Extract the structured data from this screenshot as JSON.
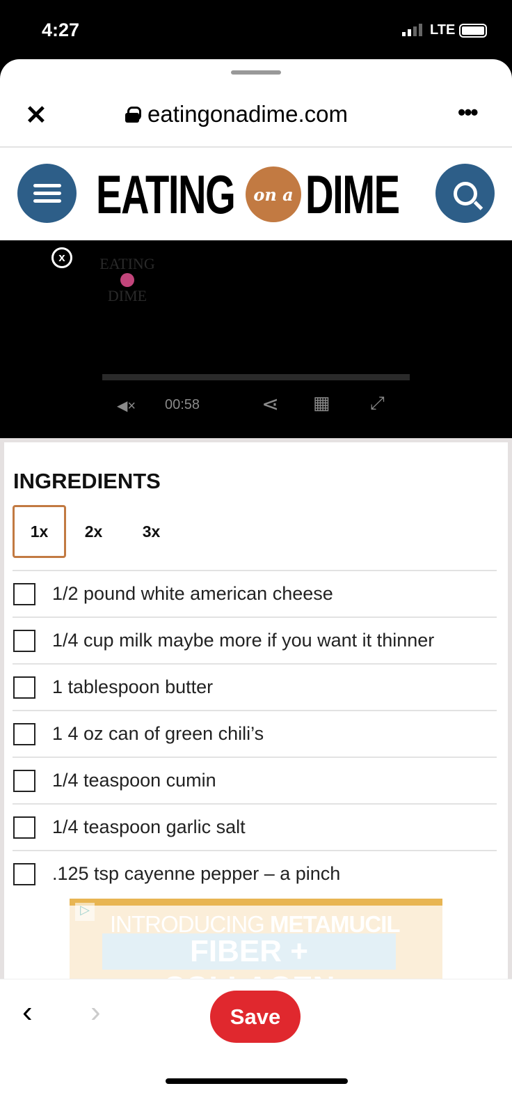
{
  "status": {
    "time": "4:27",
    "network": "LTE"
  },
  "browser": {
    "url": "eatingonadime.com",
    "close": "✕",
    "more": "•••"
  },
  "site": {
    "logo_left": "EATING",
    "logo_mid": "on a",
    "logo_right": "DIME"
  },
  "video": {
    "watermark_top": "EATING",
    "watermark_bottom": "DIME",
    "time": "00:58",
    "close": "x"
  },
  "ingredients": {
    "heading": "INGREDIENTS",
    "servings": [
      "1x",
      "2x",
      "3x"
    ],
    "selected": "1x",
    "items": [
      "1/2 pound white american cheese",
      "1/4 cup milk maybe more if you want it thinner",
      "1 tablespoon butter",
      "1 4 oz can of green chili’s",
      "1/4 teaspoon cumin",
      "1/4 teaspoon garlic salt",
      ".125 tsp cayenne pepper – a pinch"
    ]
  },
  "ad": {
    "line1_light": "INTRODUCING",
    "line1_bold": "METAMUCIL",
    "line2": "FIBER + COLLAGEN"
  },
  "bottom": {
    "back": "‹",
    "forward": "›",
    "save": "Save"
  },
  "colors": {
    "brand_blue": "#2d5e88",
    "brand_orange": "#c27a42",
    "save_red": "#e0282e"
  }
}
